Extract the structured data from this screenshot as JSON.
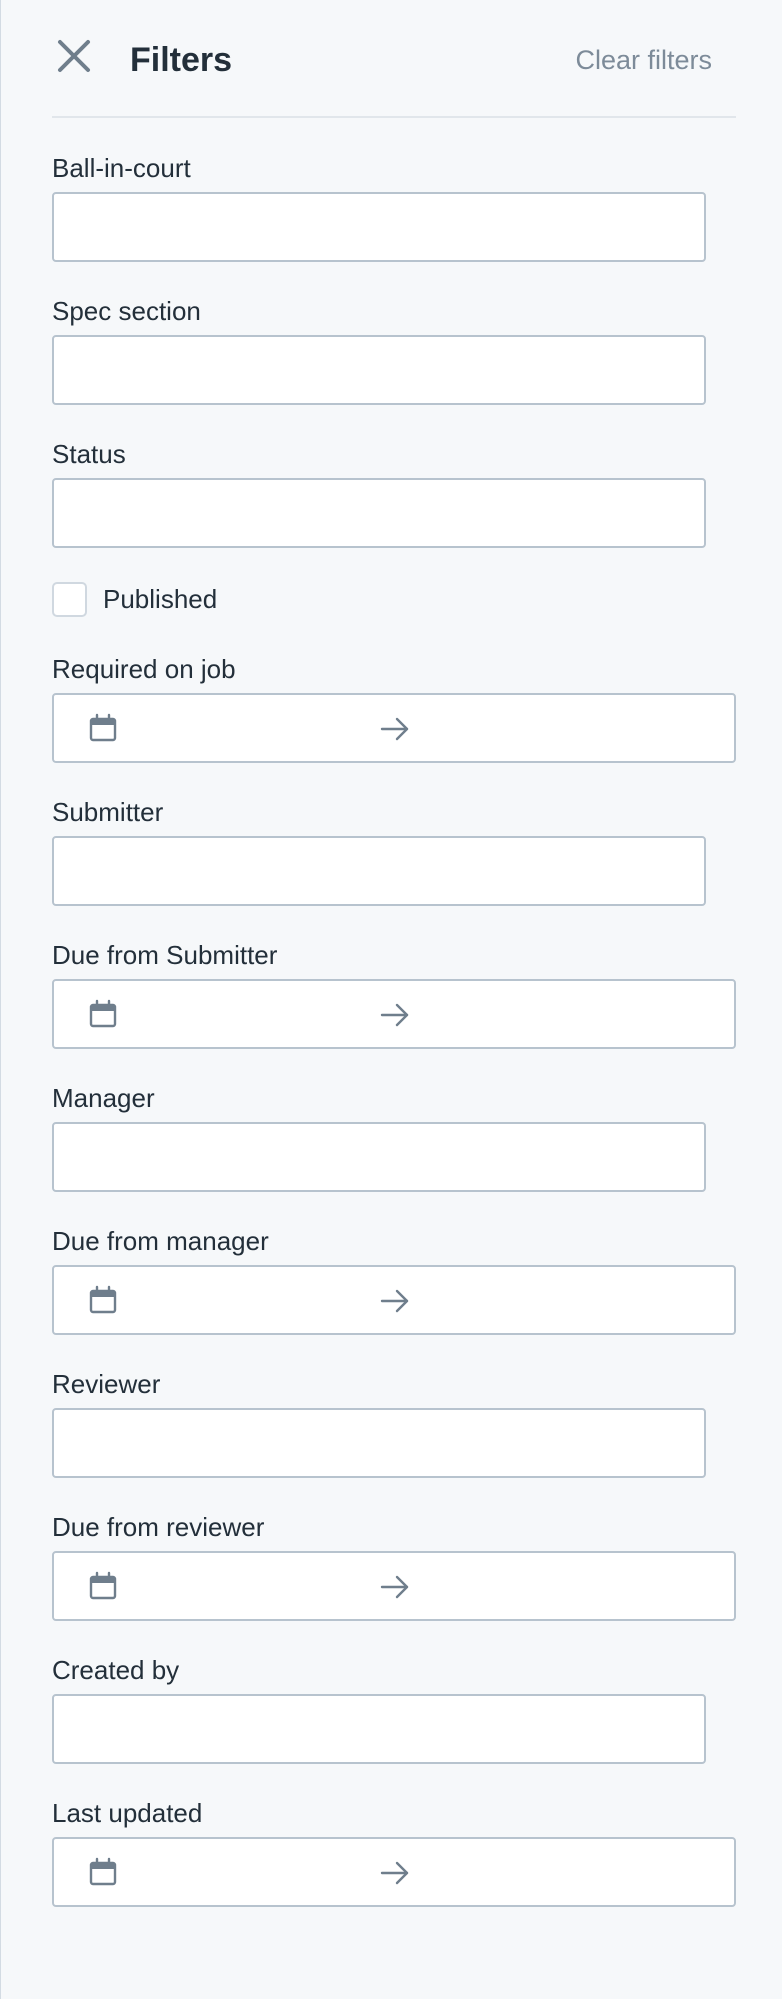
{
  "header": {
    "title": "Filters",
    "clear_label": "Clear filters",
    "close_icon": "close-icon"
  },
  "fields": {
    "ball_in_court": {
      "label": "Ball-in-court",
      "value": ""
    },
    "spec_section": {
      "label": "Spec section",
      "value": ""
    },
    "status": {
      "label": "Status",
      "value": ""
    },
    "published": {
      "label": "Published",
      "checked": false
    },
    "required_on_job": {
      "label": "Required on job",
      "start": "",
      "end": ""
    },
    "submitter": {
      "label": "Submitter",
      "value": ""
    },
    "due_from_submitter": {
      "label": "Due from Submitter",
      "start": "",
      "end": ""
    },
    "manager": {
      "label": "Manager",
      "value": ""
    },
    "due_from_manager": {
      "label": "Due from manager",
      "start": "",
      "end": ""
    },
    "reviewer": {
      "label": "Reviewer",
      "value": ""
    },
    "due_from_reviewer": {
      "label": "Due from reviewer",
      "start": "",
      "end": ""
    },
    "created_by": {
      "label": "Created by",
      "value": ""
    },
    "last_updated": {
      "label": "Last updated",
      "start": "",
      "end": ""
    }
  },
  "icons": {
    "calendar": "calendar-icon",
    "arrow": "arrow-right-icon"
  },
  "colors": {
    "background": "#f6f8fa",
    "input_border": "#b7c3ce",
    "muted_text": "#7d8b99",
    "title_text": "#232f3a"
  }
}
